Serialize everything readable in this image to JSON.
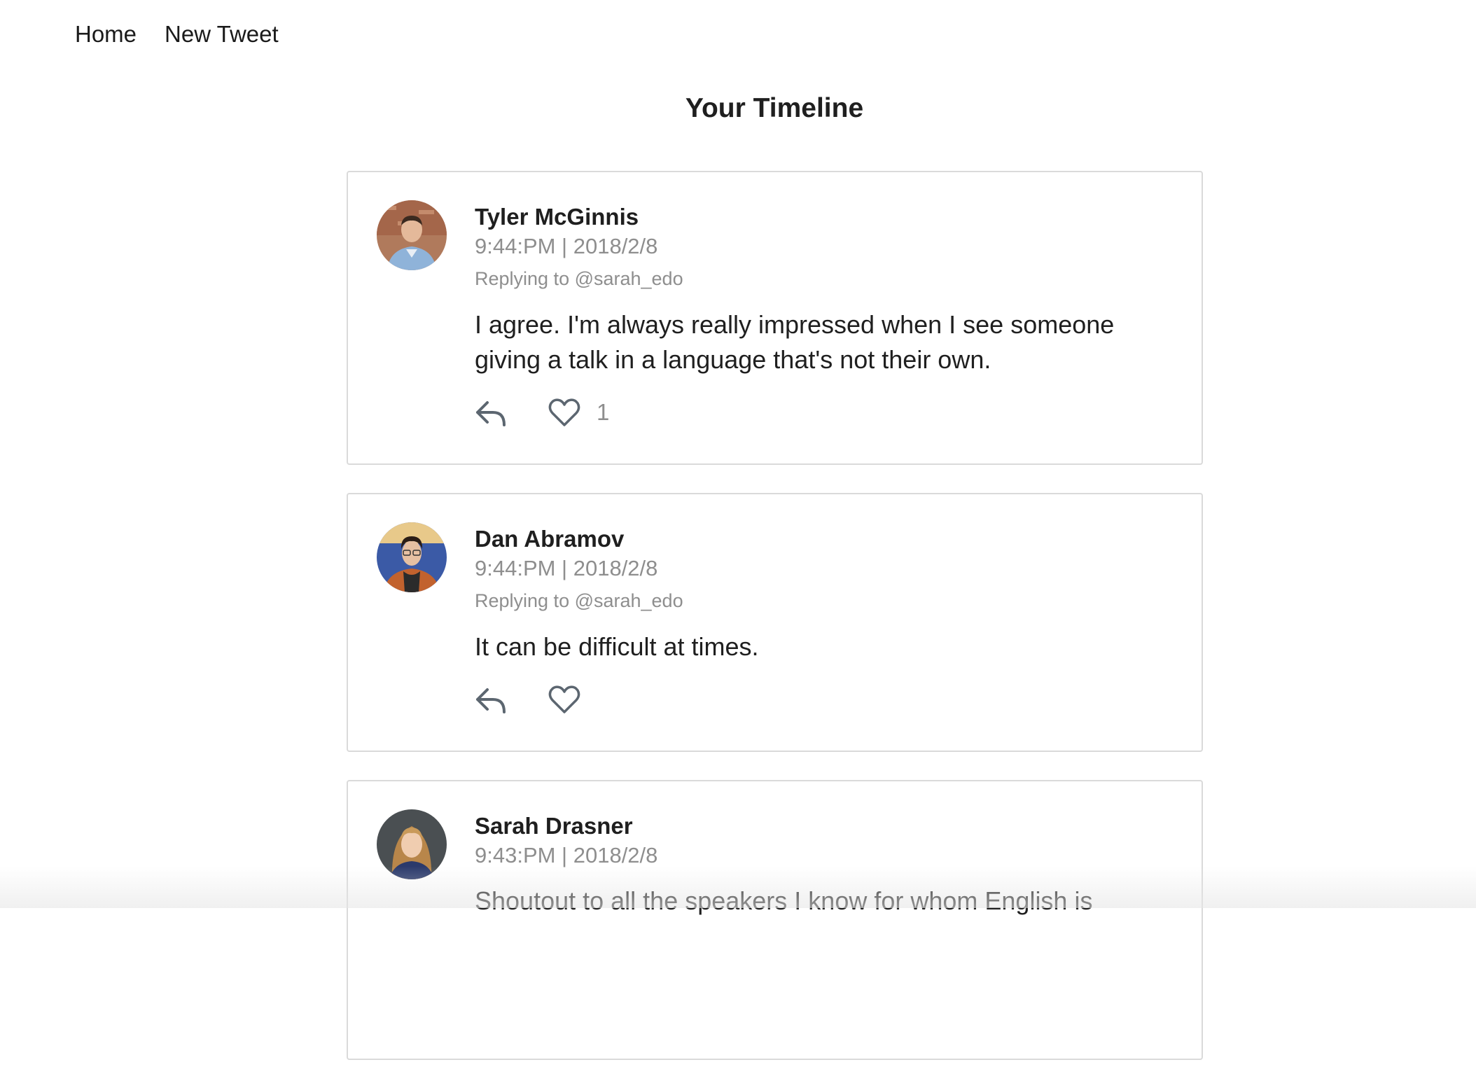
{
  "nav": {
    "home_label": "Home",
    "new_tweet_label": "New Tweet"
  },
  "page_title": "Your Timeline",
  "colors": {
    "icon": "#5c6670",
    "muted_text": "#8e8e8e",
    "card_border": "#dadada"
  },
  "tweets": [
    {
      "author": "Tyler McGinnis",
      "meta": "9:44:PM | 2018/2/8",
      "reply_to": "Replying to @sarah_edo",
      "text": "I agree. I'm always really impressed when I see someone giving a talk in a language that's not their own.",
      "like_count": "1",
      "avatar_icon": "avatar-tyler"
    },
    {
      "author": "Dan Abramov",
      "meta": "9:44:PM | 2018/2/8",
      "reply_to": "Replying to @sarah_edo",
      "text": "It can be difficult at times.",
      "like_count": "",
      "avatar_icon": "avatar-dan"
    },
    {
      "author": "Sarah Drasner",
      "meta": "9:43:PM | 2018/2/8",
      "reply_to": "",
      "text": "Shoutout to all the speakers I know for whom English is",
      "like_count": "",
      "avatar_icon": "avatar-sarah"
    }
  ]
}
